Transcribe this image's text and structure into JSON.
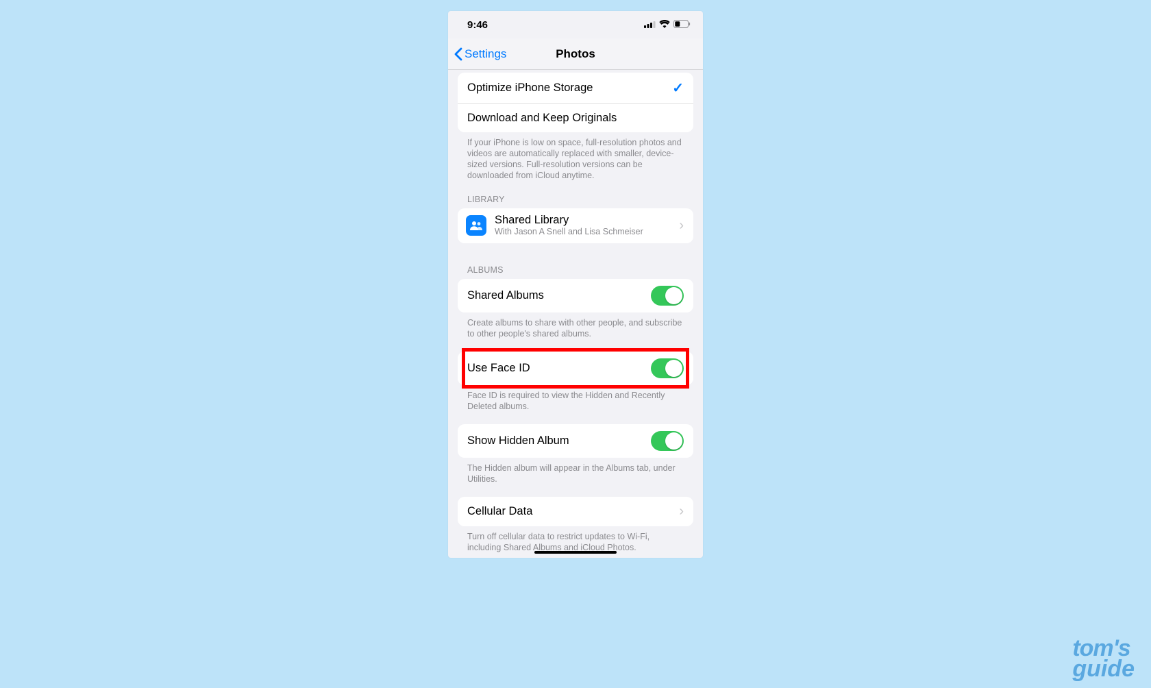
{
  "statusbar": {
    "time": "9:46"
  },
  "nav": {
    "back": "Settings",
    "title": "Photos"
  },
  "storage": {
    "optimize": "Optimize iPhone Storage",
    "download": "Download and Keep Originals",
    "footer": "If your iPhone is low on space, full-resolution photos and videos are automatically replaced with smaller, device-sized versions. Full-resolution versions can be downloaded from iCloud anytime."
  },
  "library": {
    "header": "LIBRARY",
    "shared_title": "Shared Library",
    "shared_sub": "With Jason A Snell and Lisa Schmeiser"
  },
  "albums": {
    "header": "ALBUMS",
    "shared_albums": "Shared Albums",
    "shared_albums_footer": "Create albums to share with other people, and subscribe to other people's shared albums.",
    "face_id": "Use Face ID",
    "face_id_footer": "Face ID is required to view the Hidden and Recently Deleted albums.",
    "show_hidden": "Show Hidden Album",
    "show_hidden_footer": "The Hidden album will appear in the Albums tab, under Utilities.",
    "cellular": "Cellular Data",
    "cellular_footer": "Turn off cellular data to restrict updates to Wi-Fi, including Shared Albums and iCloud Photos."
  },
  "watermark": {
    "line1": "tom's",
    "line2": "guide"
  }
}
